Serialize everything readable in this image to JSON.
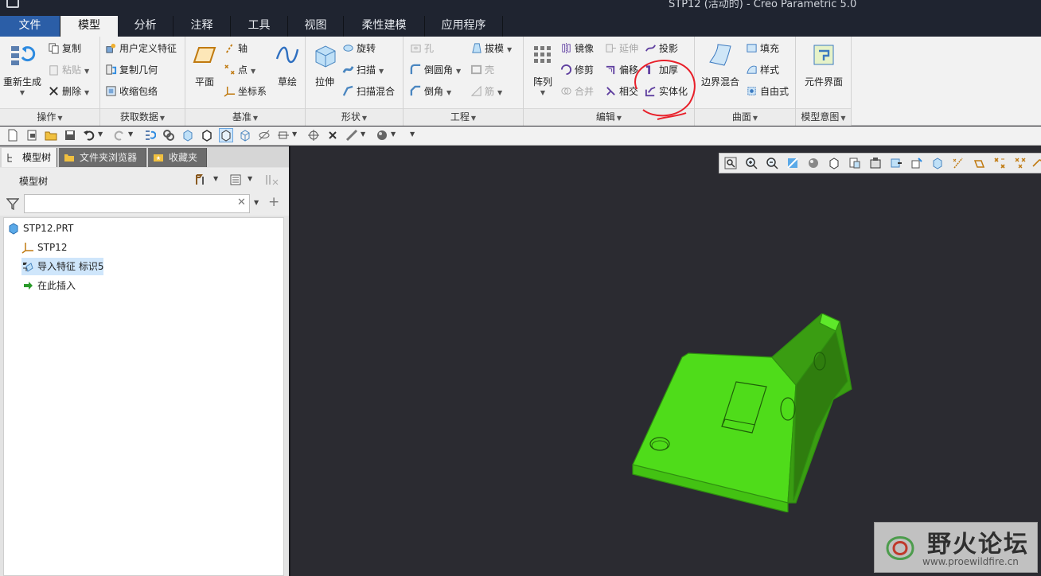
{
  "window": {
    "title": "STP12 (活动的) - Creo Parametric 5.0"
  },
  "tabs": [
    {
      "label": "文件"
    },
    {
      "label": "模型"
    },
    {
      "label": "分析"
    },
    {
      "label": "注释"
    },
    {
      "label": "工具"
    },
    {
      "label": "视图"
    },
    {
      "label": "柔性建模"
    },
    {
      "label": "应用程序"
    }
  ],
  "ribbon": {
    "operations": {
      "footer": "操作",
      "regenerate": "重新生成",
      "copy": "复制",
      "paste": "粘贴",
      "delete": "删除"
    },
    "get_data": {
      "footer": "获取数据",
      "udf": "用户定义特征",
      "copy_geom": "复制几何",
      "shrinkwrap": "收缩包络"
    },
    "datum": {
      "footer": "基准",
      "plane": "平面",
      "axis": "轴",
      "point": "点",
      "csys": "坐标系",
      "sketch": "草绘"
    },
    "shapes": {
      "footer": "形状",
      "extrude": "拉伸",
      "revolve": "旋转",
      "sweep": "扫描",
      "swept_blend": "扫描混合"
    },
    "engineering": {
      "footer": "工程",
      "hole": "孔",
      "round": "倒圆角",
      "chamfer": "倒角",
      "draft": "拔模",
      "shell": "壳",
      "rib": "筋"
    },
    "editing": {
      "footer": "编辑",
      "pattern": "阵列",
      "mirror": "镜像",
      "trim": "修剪",
      "merge": "合并",
      "extend": "延伸",
      "offset": "偏移",
      "intersect": "相交",
      "project": "投影",
      "thicken": "加厚",
      "solidify": "实体化"
    },
    "surfaces": {
      "footer": "曲面",
      "boundary_blend": "边界混合",
      "fill": "填充",
      "style": "样式",
      "freestyle": "自由式"
    },
    "model_intent": {
      "footer": "模型意图",
      "component_interface": "元件界面"
    }
  },
  "nav_tabs": [
    {
      "label": "模型树"
    },
    {
      "label": "文件夹浏览器"
    },
    {
      "label": "收藏夹"
    }
  ],
  "model_tree": {
    "header": "模型树",
    "search_placeholder": "",
    "items": [
      {
        "label": "STP12.PRT"
      },
      {
        "label": "STP12"
      },
      {
        "label": "导入特征 标识5"
      },
      {
        "label": "在此插入"
      }
    ]
  },
  "watermark": {
    "text": "野火论坛",
    "url": "www.proewildfire.cn"
  },
  "colors": {
    "model": "#4fdc1a",
    "viewport": "#2b2b31",
    "annotation": "#e8202a",
    "file_tab": "#2b5ea7"
  }
}
